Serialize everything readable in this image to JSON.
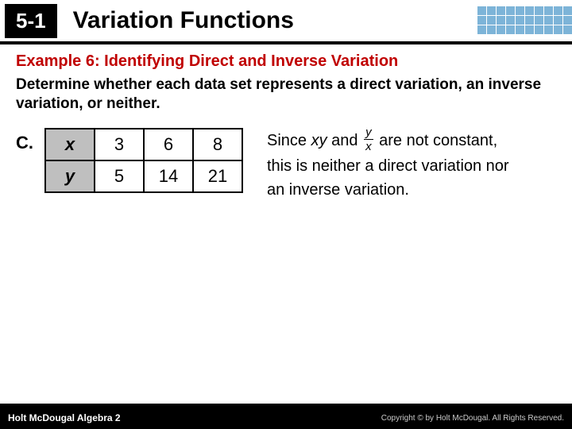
{
  "header": {
    "section_number": "5-1",
    "title": "Variation Functions"
  },
  "example_title": "Example 6: Identifying Direct and Inverse Variation",
  "prompt": "Determine whether each data set represents a direct variation, an inverse variation, or neither.",
  "part_label": "C.",
  "table": {
    "row_x_label": "x",
    "row_y_label": "y",
    "x": [
      "3",
      "6",
      "8"
    ],
    "y": [
      "5",
      "14",
      "21"
    ]
  },
  "explanation": {
    "pre": "Since ",
    "xy": "xy",
    "and": " and ",
    "frac_num": "y",
    "frac_den": "x",
    "post": " are not constant, this is neither a direct variation nor an inverse variation."
  },
  "footer": {
    "left": "Holt McDougal Algebra 2",
    "right": "Copyright © by Holt McDougal. All Rights Reserved."
  }
}
